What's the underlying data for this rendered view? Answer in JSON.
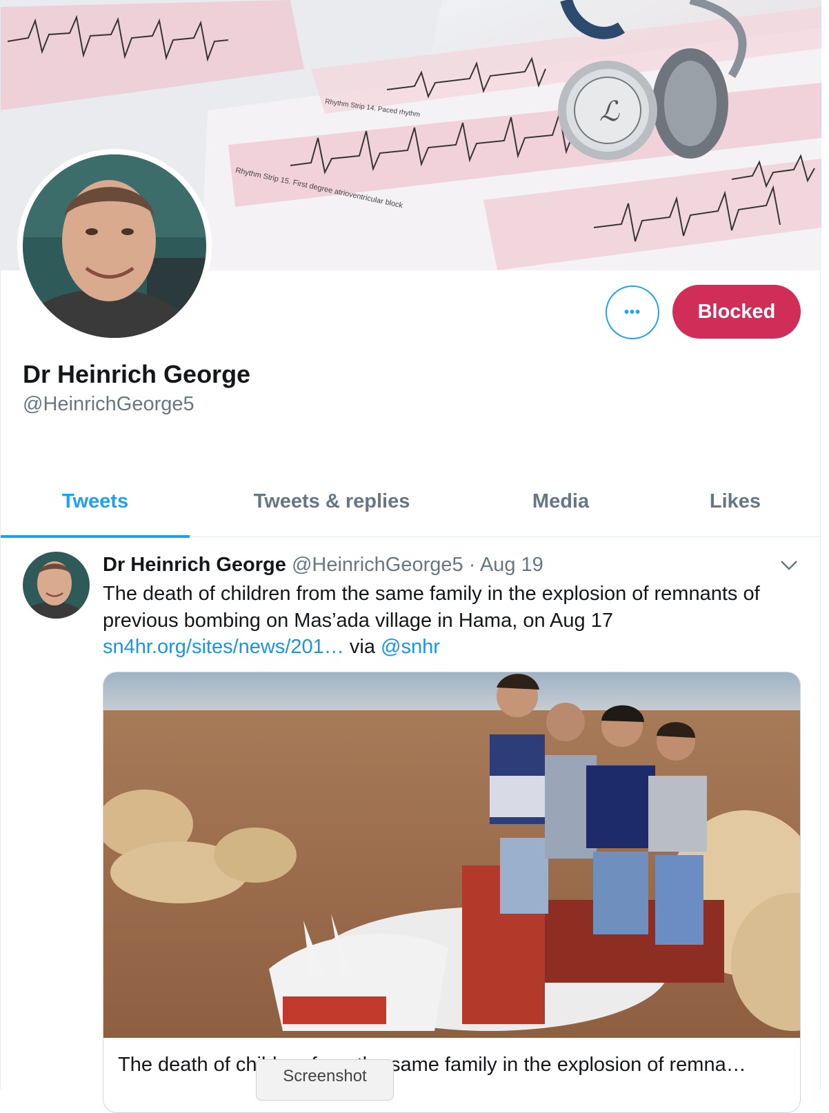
{
  "profile": {
    "display_name": "Dr Heinrich George",
    "handle": "@HeinrichGeorge5",
    "more_label": "•••",
    "blocked_label": "Blocked"
  },
  "tabs": [
    {
      "label": "Tweets",
      "active": true
    },
    {
      "label": "Tweets & replies",
      "active": false
    },
    {
      "label": "Media",
      "active": false
    },
    {
      "label": "Likes",
      "active": false
    }
  ],
  "tweet": {
    "name": "Dr Heinrich George",
    "handle": "@HeinrichGeorge5",
    "separator": "·",
    "date": "Aug 19",
    "text_line1": "The death of children from the same family in the explosion of remnants of",
    "text_line2": "previous bombing on Mas’ada village in Hama, on Aug 17",
    "link": "sn4hr.org/sites/news/201…",
    "via": "via",
    "mention": "@snhr",
    "card_title": "The death of children from the same family in the explosion of remna…"
  },
  "tooltip": "Screenshot",
  "colors": {
    "accent": "#1da1f2",
    "blocked": "#d02d59",
    "secondary_text": "#657786",
    "link": "#1b95e0"
  },
  "icons": {
    "more": "more-dots-icon",
    "caret": "chevron-down-icon"
  }
}
